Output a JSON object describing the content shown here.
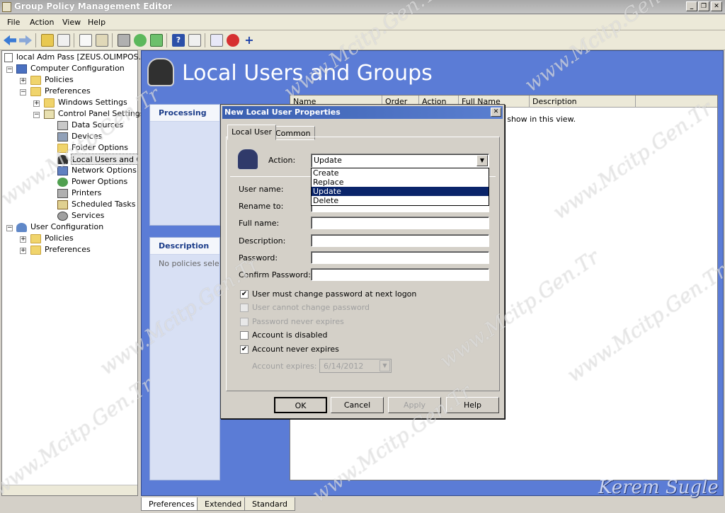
{
  "window": {
    "title": "Group Policy Management Editor",
    "min": "_",
    "restore": "❐",
    "close": "✕"
  },
  "menu": [
    "File",
    "Action",
    "View",
    "Help"
  ],
  "tree": {
    "root": "local Adm Pass [ZEUS.OLIMPOS.LC",
    "computer_config": "Computer Configuration",
    "policies": "Policies",
    "preferences": "Preferences",
    "windows_settings": "Windows Settings",
    "control_panel_settings": "Control Panel Settings",
    "items": [
      "Data Sources",
      "Devices",
      "Folder Options",
      "Local Users and Gr",
      "Network Options",
      "Power Options",
      "Printers",
      "Scheduled Tasks",
      "Services"
    ],
    "user_config": "User Configuration",
    "user_policies": "Policies",
    "user_preferences": "Preferences"
  },
  "main": {
    "banner": "Local Users and Groups",
    "processing": "Processing",
    "description": "Description",
    "no_policies": "No policies selecte",
    "columns": [
      "Name",
      "Order",
      "Action",
      "Full Name",
      "Description"
    ],
    "empty_msg": "o show in this view."
  },
  "dialog": {
    "title": "New Local User Properties",
    "close": "✕",
    "tabs": [
      "Local User",
      "Common"
    ],
    "action_label": "Action:",
    "action_value": "Update",
    "action_options": [
      "Create",
      "Replace",
      "Update",
      "Delete"
    ],
    "labels": {
      "user_name": "User name:",
      "rename_to": "Rename to:",
      "full_name": "Full name:",
      "description": "Description:",
      "password": "Password:",
      "confirm_password": "Confirm Password:"
    },
    "checks": {
      "must_change": "User must change password at next logon",
      "cannot_change": "User cannot change password",
      "never_expires": "Password never expires",
      "disabled": "Account is disabled",
      "account_never_expires": "Account never expires",
      "account_expires": "Account expires:",
      "expires_date": "6/14/2012"
    },
    "buttons": {
      "ok": "OK",
      "cancel": "Cancel",
      "apply": "Apply",
      "help": "Help"
    }
  },
  "bottom_tabs": [
    "Preferences",
    "Extended",
    "Standard"
  ],
  "watermarks": {
    "a": "www.Mcitp.Gen.Tr",
    "b": "Kerem Sugle"
  }
}
